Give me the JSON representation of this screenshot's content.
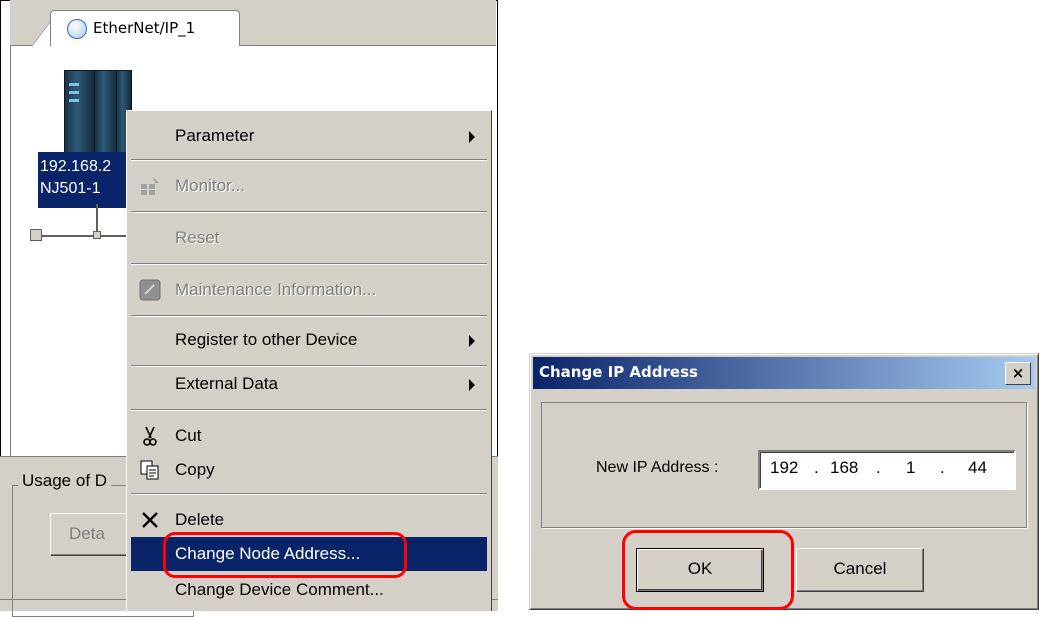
{
  "left_panel": {
    "tab": {
      "label": "EtherNet/IP_1",
      "icon": "network-globe-icon"
    },
    "device": {
      "ip_line": "192.168.2",
      "model_line": "NJ501-1",
      "icon": "plc-controller-icon"
    },
    "usage_group_label": "Usage of D",
    "detail_button_label": "Deta"
  },
  "context_menu": {
    "items": [
      {
        "label": "Parameter",
        "submenu": true,
        "enabled": true
      },
      {
        "label": "Monitor...",
        "enabled": false,
        "icon": "monitor-icon"
      },
      {
        "label": "Reset",
        "enabled": false
      },
      {
        "label": "Maintenance Information...",
        "enabled": false,
        "icon": "maintenance-icon"
      },
      {
        "label": "Register to other Device",
        "submenu": true,
        "enabled": true
      },
      {
        "label": "External Data",
        "submenu": true,
        "enabled": true
      },
      {
        "label": "Cut",
        "enabled": true,
        "icon": "scissors-icon"
      },
      {
        "label": "Copy",
        "enabled": true,
        "icon": "copy-icon"
      },
      {
        "label": "Delete",
        "enabled": true,
        "icon": "delete-x-icon"
      },
      {
        "label": "Change Node Address...",
        "enabled": true,
        "selected": true
      },
      {
        "label": "Change Device Comment...",
        "enabled": true
      }
    ]
  },
  "dialog": {
    "title": "Change IP Address",
    "close_label": "×",
    "ip_label": "New IP Address :",
    "ip_segments": [
      "192",
      ".",
      "168",
      ".",
      "1",
      ".",
      "44"
    ],
    "ok_label": "OK",
    "cancel_label": "Cancel"
  },
  "colors": {
    "highlight": "#ff0000",
    "selection": "#0a246a",
    "face": "#d4d0c8"
  }
}
